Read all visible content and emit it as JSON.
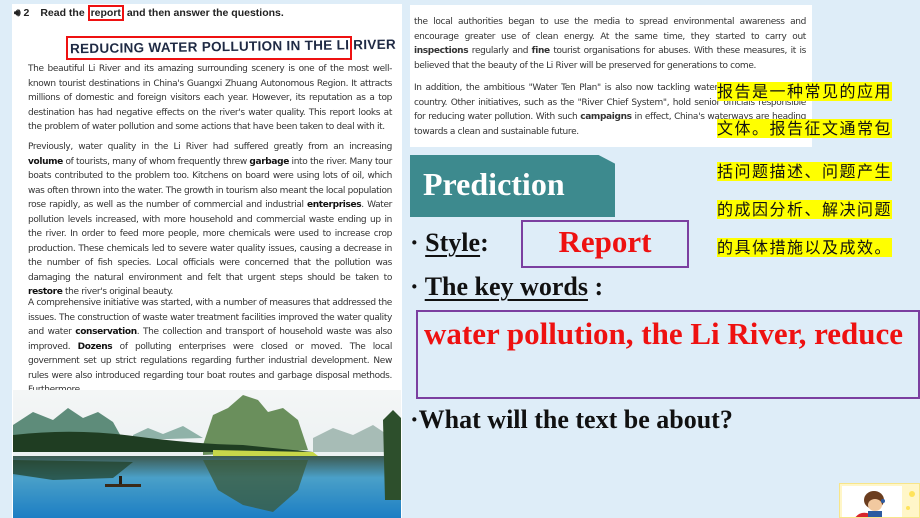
{
  "left_page": {
    "instruction": {
      "icon": "audio-icon",
      "number": "2",
      "before": "Read the ",
      "highlight": "report",
      "after": " and then answer the questions."
    },
    "title": "REDUCING WATER POLLUTION IN THE LI RIVER",
    "paragraphs": [
      {
        "segments": [
          {
            "t": "The beautiful Li River and its amazing surrounding scenery is one of the most well-known tourist destinations in China's Guangxi Zhuang Autonomous Region. It attracts millions of domestic and foreign visitors each year. However, its reputation as a top destination has had negative effects on the river's water quality. This report looks at the problem of water pollution and some actions that have been taken to deal with it.",
            "b": false
          }
        ]
      },
      {
        "segments": [
          {
            "t": "Previously, water quality in the Li River had suffered greatly from an increasing ",
            "b": false
          },
          {
            "t": "volume",
            "b": true
          },
          {
            "t": " of tourists, many of whom frequently threw ",
            "b": false
          },
          {
            "t": "garbage",
            "b": true
          },
          {
            "t": " into the river. Many tour boats contributed to the problem too. Kitchens on board were using lots of oil, which was often thrown into the water. The growth in tourism also meant the local population rose rapidly, as well as the number of commercial and industrial ",
            "b": false
          },
          {
            "t": "enterprises",
            "b": true
          },
          {
            "t": ". Water pollution levels increased, with more household and commercial waste ending up in the river. In order to feed more people, more chemicals were used to increase crop production. These chemicals led to severe water quality issues, causing a decrease in the number of fish species. Local officials were concerned that the pollution was damaging the natural environment and felt that urgent steps should be taken to ",
            "b": false
          },
          {
            "t": "restore",
            "b": true
          },
          {
            "t": " the river's original beauty.",
            "b": false
          }
        ]
      },
      {
        "segments": [
          {
            "t": "A comprehensive initiative was started, with a number of measures that addressed the issues. The construction of waste water treatment facilities improved the water quality and water ",
            "b": false
          },
          {
            "t": "conservation",
            "b": true
          },
          {
            "t": ". The collection and transport of household waste was also improved. ",
            "b": false
          },
          {
            "t": "Dozens",
            "b": true
          },
          {
            "t": " of polluting enterprises were closed or moved. The local government set up strict regulations regarding further industrial development. New rules were also introduced regarding tour boat routes and garbage disposal methods. Furthermore,",
            "b": false
          }
        ]
      }
    ],
    "photo_alt": "Li River karst landscape"
  },
  "right_page": {
    "paragraphs": [
      {
        "segments": [
          {
            "t": "the local authorities began to use the media to spread environmental awareness and encourage greater use of clean energy. At the same time, they started to carry out ",
            "b": false
          },
          {
            "t": "inspections",
            "b": true
          },
          {
            "t": " regularly and ",
            "b": false
          },
          {
            "t": "fine",
            "b": true
          },
          {
            "t": " tourist organisations for abuses. With these measures, it is believed that the beauty of the Li River will be preserved for generations to come.",
            "b": false
          }
        ]
      },
      {
        "segments": [
          {
            "t": "In addition, the ambitious \"Water Ten Plan\" is also now tackling water pollution across the country. Other initiatives, such as the \"River Chief System\", hold senior officials responsible for reducing water pollution. With such ",
            "b": false
          },
          {
            "t": "campaigns",
            "b": true
          },
          {
            "t": " in effect, China's waterways are heading towards a clean and sustainable future.",
            "b": false
          }
        ]
      }
    ]
  },
  "chinese_note": [
    "报告是一种常见的应用",
    "文体。报告征文通常包",
    "括问题描述、问题产生",
    "的成因分析、解决问题",
    "的具体措施以及成效。"
  ],
  "prediction": {
    "header": "Prediction",
    "style_label": "Style",
    "style_colon": ":",
    "style_answer": "Report",
    "keywords_label": "The key words",
    "keywords_colon": " :",
    "keywords_answer": "water pollution, the Li River, reduce",
    "question": "What will the text be about?",
    "bullet": "·"
  },
  "colors": {
    "background": "#deedf8",
    "prediction_tab": "#3d8a8e",
    "answer_red": "#ee1111",
    "box_purple": "#7b3fa0",
    "highlight_yellow": "#ffff00"
  }
}
